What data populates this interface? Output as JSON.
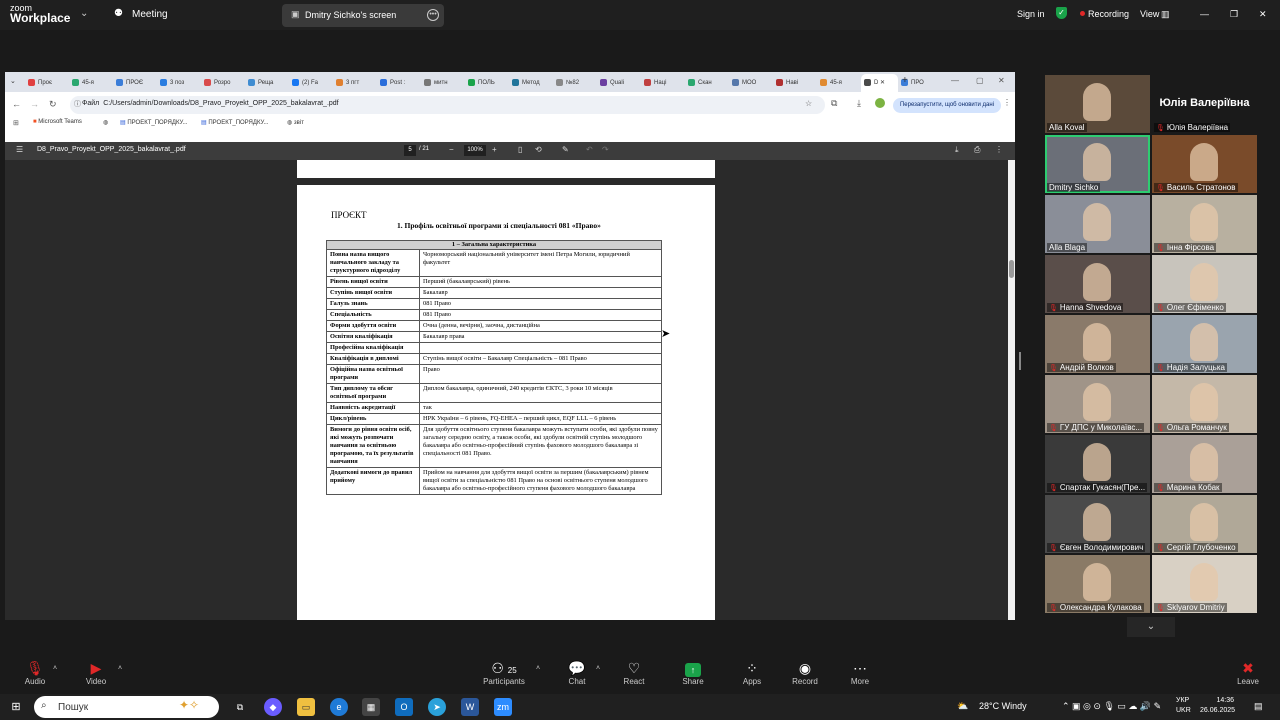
{
  "zoom_top": {
    "logo_line1": "zoom",
    "logo_line2": "Workplace",
    "meeting_label": "Meeting",
    "share_tab_label": "Dmitry Sichko's screen",
    "sign_in": "Sign in",
    "recording": "Recording",
    "view": "View"
  },
  "chrome": {
    "tabs": [
      "Проє",
      "45-я",
      "ПРОЄ",
      "3 поз",
      "Розро",
      "Реща",
      "(2) Fa",
      "3 пгт",
      "Post :",
      "митн",
      "ПОЛЬ",
      "Метод",
      "№82",
      "Quali",
      "Наці",
      "Скан",
      "МОО",
      "Наві",
      "45-я",
      "D",
      "ПРО"
    ],
    "address_prefix": "Файл",
    "address": "C:/Users/admin/Downloads/D8_Pravo_Proyekt_OPP_2025_bakalavrat_.pdf",
    "update_button": "Перезапустити, щоб оновити дані",
    "bookmarks": [
      "Microsoft Teams",
      "ПРОЕКТ_ПОРЯДКУ...",
      "ПРОЕКТ_ПОРЯДКУ...",
      "звіт"
    ]
  },
  "pdf": {
    "title": "D8_Pravo_Proyekt_OPP_2025_bakalavrat_.pdf",
    "page_current": "5",
    "page_total": "/ 21",
    "zoom": "100%",
    "doc_label": "ПРОЄКТ",
    "doc_title": "1. Профіль освітньої програми зі спеціальності 081 «Право»",
    "section_header": "1 – Загальна характеристика",
    "rows": [
      {
        "k": "Повна назва вищого навчального закладу та структурного підрозділу",
        "v": "Чорноморський національний університет імені Петра Могили, юридичний факультет"
      },
      {
        "k": "Рівень вищої освіти",
        "v": "Перший (бакалаврський) рівень"
      },
      {
        "k": "Ступінь вищої освіти",
        "v": "Бакалавр"
      },
      {
        "k": "Галузь знань",
        "v": "081 Право"
      },
      {
        "k": "Спеціальність",
        "v": "081 Право"
      },
      {
        "k": "Форми здобуття освіти",
        "v": "Очна (денна, вечірня), заочна, дистанційна"
      },
      {
        "k": "Освітня кваліфікація",
        "v": "Бакалавр права"
      },
      {
        "k": "Професійна кваліфікація",
        "v": ""
      },
      {
        "k": "Кваліфікація в дипломі",
        "v": "Ступінь вищої освіти – Бакалавр Спеціальність – 081 Право"
      },
      {
        "k": "Офіційна назва освітньої програми",
        "v": "Право"
      },
      {
        "k": "Тип диплому та обсяг освітньої програми",
        "v": "Диплом бакалавра, одиничний, 240 кредитів ЄКТС, 3 роки 10 місяців"
      },
      {
        "k": "Наявність акредитації",
        "v": "так"
      },
      {
        "k": "Цикл/рівень",
        "v": "НРК України – 6 рівень, FQ-EHEA – перший цикл, EQF LLL – 6 рівень"
      },
      {
        "k": "Вимоги до рівня освіти осіб, які можуть розпочати навчання за освітньою програмою, та їх результатів навчання",
        "v": "Для здобуття освітнього ступеня бакалавра можуть вступати особи, які здобули повну загальну середню освіту, а також особи, які здобули освітній ступінь молодшого бакалавра або освітньо-професійний ступінь фахового молодшого бакалавра зі спеціальності 081 Право."
      },
      {
        "k": "Додаткові вимоги до правил прийому",
        "v": "Прийом на навчання для здобуття вищої освіти за першим (бакалаврським) рівнем вищої освіти за спеціальністю 081 Право на основі освітнього ступеня молодшого бакалавра або освітньо-професійного ступеня фахового молодшого бакалавра"
      }
    ]
  },
  "participants": [
    {
      "name": "Alla Koval",
      "muted": false
    },
    {
      "name": "Юлія Валеріївна",
      "muted": true,
      "name_only": true,
      "big": "Юлія Валеріївна"
    },
    {
      "name": "Dmitry Sichko",
      "muted": false,
      "highlight": true
    },
    {
      "name": "Василь Стратонов",
      "muted": true
    },
    {
      "name": "Alla Blaga",
      "muted": false
    },
    {
      "name": "Інна Фірсова",
      "muted": true
    },
    {
      "name": "Hanna Shvedova",
      "muted": true
    },
    {
      "name": "Олег Єфіменко",
      "muted": true
    },
    {
      "name": "Андрій Волков",
      "muted": true
    },
    {
      "name": "Надія Залуцька",
      "muted": true
    },
    {
      "name": "ГУ ДПС у Миколаївс...",
      "muted": true
    },
    {
      "name": "Ольга Романчук",
      "muted": true
    },
    {
      "name": "Спартак Гукасян(Пре...",
      "muted": true
    },
    {
      "name": "Марина Кобак",
      "muted": true
    },
    {
      "name": "Євген Володимирович",
      "muted": true
    },
    {
      "name": "Сергій Глубоченко",
      "muted": true
    },
    {
      "name": "Олександра Кулакова",
      "muted": true
    },
    {
      "name": "Sklyarov Dmitriy",
      "muted": true
    }
  ],
  "controls": {
    "audio": "Audio",
    "video": "Video",
    "participants_count": "25",
    "participants": "Participants",
    "chat": "Chat",
    "react": "React",
    "share": "Share",
    "apps": "Apps",
    "record": "Record",
    "more": "More",
    "leave": "Leave"
  },
  "taskbar": {
    "search_placeholder": "Пошук",
    "weather": "28°C  Windy",
    "lang1": "УКР",
    "lang2": "UKR",
    "time": "14:36",
    "date": "26.06.2025"
  },
  "colors": {
    "zoom_green": "#1aa34a",
    "recording_red": "#e02828",
    "active_speaker": "#2ecc71"
  }
}
